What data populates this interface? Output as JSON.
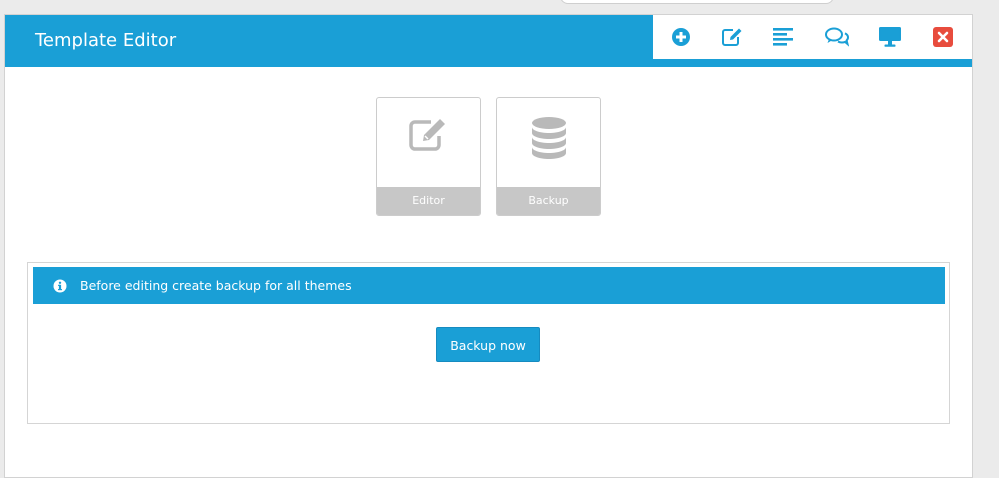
{
  "window": {
    "title": "Template Editor"
  },
  "toolbar": {
    "buttons": [
      {
        "name": "add",
        "icon": "plus-circle-icon",
        "color": "#1a9fd6"
      },
      {
        "name": "edit",
        "icon": "edit-icon",
        "color": "#1a9fd6"
      },
      {
        "name": "align",
        "icon": "align-left-icon",
        "color": "#1a9fd6"
      },
      {
        "name": "comments",
        "icon": "comments-icon",
        "color": "#1a9fd6"
      },
      {
        "name": "desktop",
        "icon": "desktop-icon",
        "color": "#1a9fd6"
      },
      {
        "name": "close",
        "icon": "close-icon",
        "color": "#e84c3d"
      }
    ]
  },
  "tiles": [
    {
      "label": "Editor",
      "icon": "edit-icon"
    },
    {
      "label": "Backup",
      "icon": "database-icon"
    }
  ],
  "notice": {
    "icon": "info-icon",
    "text": "Before editing create backup for all themes"
  },
  "actions": {
    "backup_label": "Backup now"
  },
  "colors": {
    "accent": "#1a9fd6",
    "danger": "#e84c3d",
    "tile_label_bg": "#c7c7c7",
    "tile_icon": "#b9b9b9"
  }
}
